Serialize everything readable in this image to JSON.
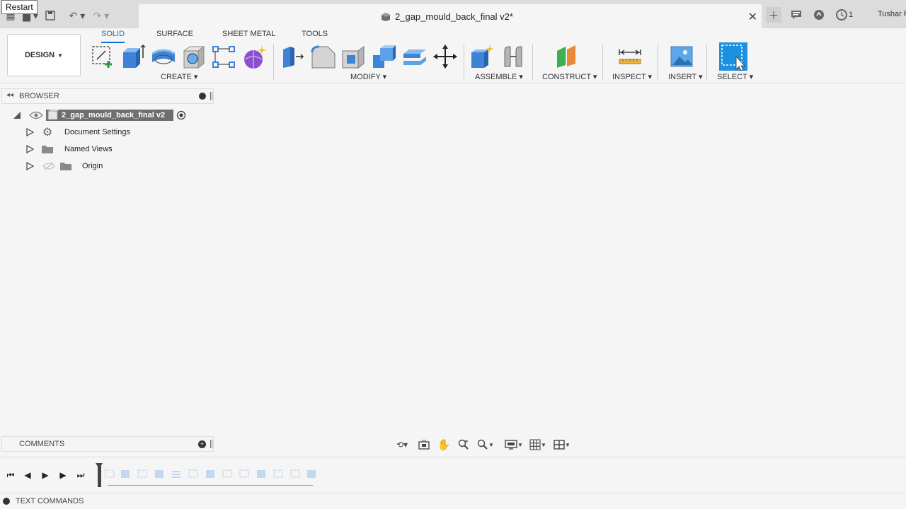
{
  "tooltip": "Restart",
  "document": {
    "title": "2_gap_mould_back_final v2*"
  },
  "user": {
    "name": "Tushar R",
    "job_count": "1"
  },
  "toolbar": {
    "workspace": "DESIGN",
    "tabs": [
      "SOLID",
      "SURFACE",
      "SHEET METAL",
      "TOOLS"
    ],
    "active_tab": "SOLID",
    "groups": {
      "create": "CREATE",
      "modify": "MODIFY",
      "assemble": "ASSEMBLE",
      "construct": "CONSTRUCT",
      "inspect": "INSPECT",
      "insert": "INSERT",
      "select": "SELECT"
    }
  },
  "browser": {
    "title": "BROWSER",
    "root": "2_gap_mould_back_final v2",
    "items": [
      "Document Settings",
      "Named Views",
      "Origin"
    ]
  },
  "comments": {
    "title": "COMMENTS"
  },
  "text_commands": {
    "title": "TEXT COMMANDS"
  },
  "colors": {
    "accent": "#0a6ed1",
    "select_blue": "#1e90e0",
    "extrude_blue": "#4a90d9",
    "form_purple": "#8a4fd0"
  }
}
